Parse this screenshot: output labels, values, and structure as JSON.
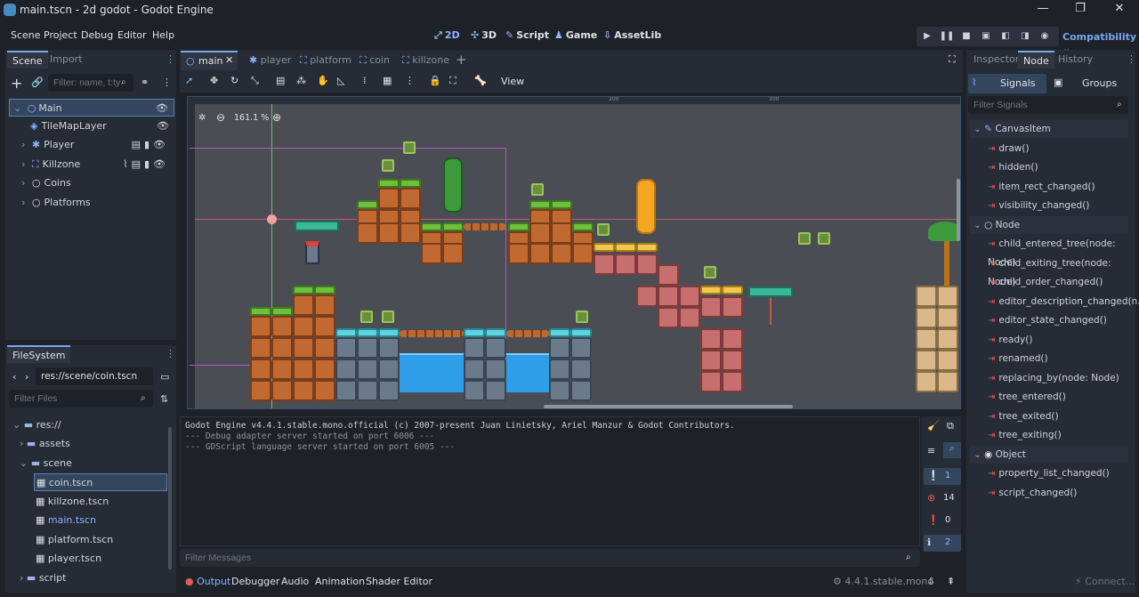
{
  "window": {
    "title": "main.tscn - 2d godot - Godot Engine"
  },
  "menu": [
    "Scene",
    "Project",
    "Debug",
    "Editor",
    "Help"
  ],
  "workspaces": [
    {
      "label": "2D",
      "icon": "arrows-icon"
    },
    {
      "label": "3D",
      "icon": "cube-icon"
    },
    {
      "label": "Script",
      "icon": "script-icon"
    },
    {
      "label": "Game",
      "icon": "game-icon"
    },
    {
      "label": "AssetLib",
      "icon": "assetlib-icon"
    }
  ],
  "renderer": "Compatibility",
  "scene_dock": {
    "tabs": [
      "Scene",
      "Import"
    ],
    "filter_placeholder": "Filter: name, t:ty",
    "nodes": [
      {
        "name": "Main"
      },
      {
        "name": "TileMapLayer"
      },
      {
        "name": "Player"
      },
      {
        "name": "Killzone"
      },
      {
        "name": "Coins"
      },
      {
        "name": "Platforms"
      }
    ]
  },
  "filesystem": {
    "tab": "FileSystem",
    "path": "res://scene/coin.tscn",
    "filter_placeholder": "Filter Files",
    "items": [
      {
        "label": "res://"
      },
      {
        "label": "assets"
      },
      {
        "label": "scene"
      },
      {
        "label": "coin.tscn"
      },
      {
        "label": "killzone.tscn"
      },
      {
        "label": "main.tscn"
      },
      {
        "label": "platform.tscn"
      },
      {
        "label": "player.tscn"
      },
      {
        "label": "script"
      }
    ]
  },
  "scene_tabs": [
    "main",
    "player",
    "platform",
    "coin",
    "killzone"
  ],
  "toolbar": {
    "view_label": "View"
  },
  "viewport": {
    "zoom": "161.1 %",
    "ruler_marks": [
      "200",
      "300"
    ]
  },
  "output": {
    "lines": [
      "Godot Engine v4.4.1.stable.mono.official (c) 2007-present Juan Linietsky, Ariel Manzur & Godot Contributors.",
      "--- Debug adapter server started on port 6006 ---",
      "--- GDScript language server started on port 6005 ---"
    ],
    "filter_placeholder": "Filter Messages",
    "counts": {
      "messages": "1",
      "errors": "14",
      "warnings": "0",
      "info": "2"
    }
  },
  "bottom_tabs": [
    "Output",
    "Debugger",
    "Audio",
    "Animation",
    "Shader Editor"
  ],
  "version": "4.4.1.stable.mono",
  "inspector": {
    "tabs": [
      "Inspector",
      "Node",
      "History"
    ],
    "subtabs": [
      "Signals",
      "Groups"
    ],
    "filter_placeholder": "Filter Signals",
    "sections": [
      {
        "title": "CanvasItem",
        "signals": [
          "draw()",
          "hidden()",
          "item_rect_changed()",
          "visibility_changed()"
        ]
      },
      {
        "title": "Node",
        "signals": [
          "child_entered_tree(node: Node)",
          "child_exiting_tree(node: Node)",
          "child_order_changed()",
          "editor_description_changed(n...",
          "editor_state_changed()",
          "ready()",
          "renamed()",
          "replacing_by(node: Node)",
          "tree_entered()",
          "tree_exited()",
          "tree_exiting()"
        ]
      },
      {
        "title": "Object",
        "signals": [
          "property_list_changed()",
          "script_changed()"
        ]
      }
    ],
    "connect_label": "Connect..."
  },
  "colors": {
    "accent": "#7aa6f0",
    "panel": "#262c35",
    "background": "#1d2229"
  }
}
